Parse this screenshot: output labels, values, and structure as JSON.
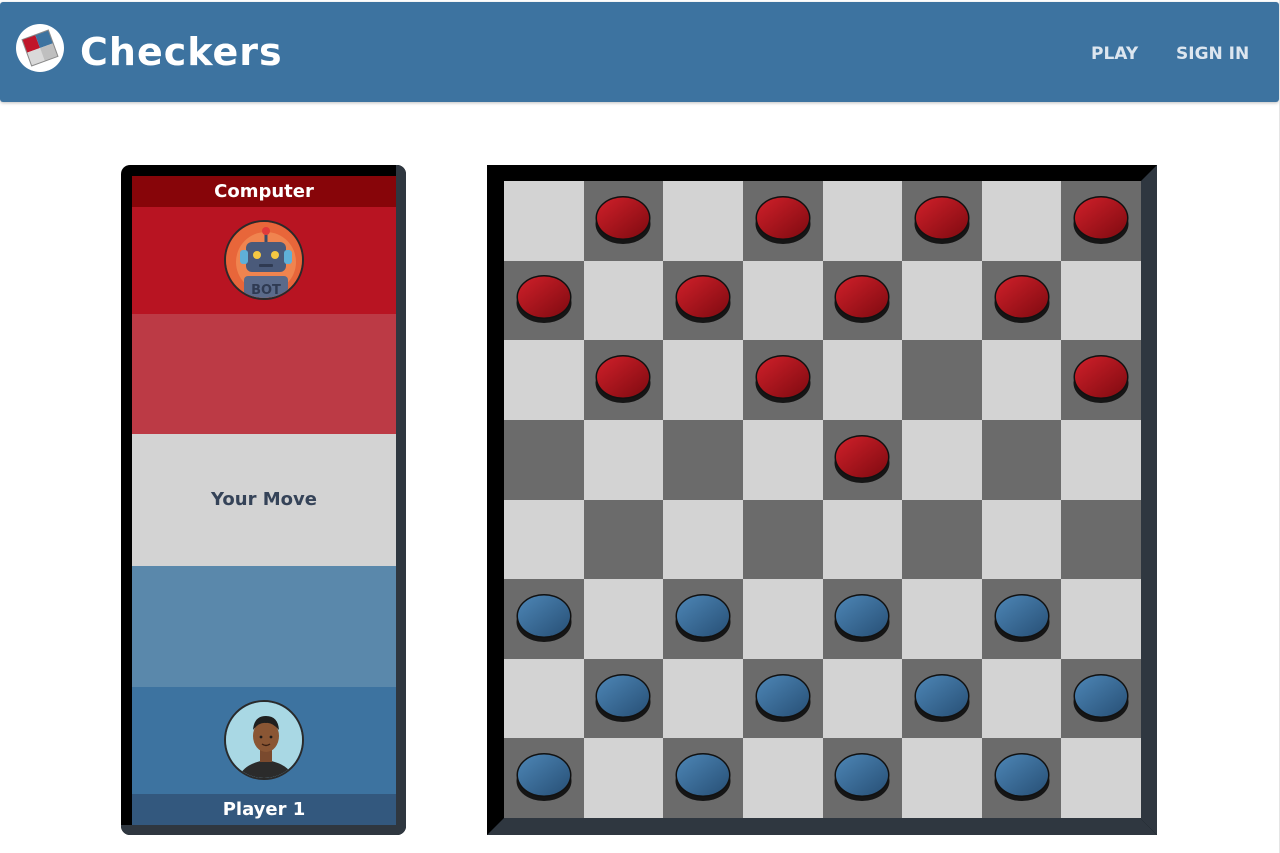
{
  "app": {
    "brand": "Checkers",
    "logo_icon": "checkers-logo-icon"
  },
  "nav": {
    "play": "PLAY",
    "sign_in": "SIGN IN"
  },
  "panel": {
    "opponent_name": "Computer",
    "opponent_avatar_icon": "robot-avatar-icon",
    "opponent_avatar_text": "BOT",
    "status": "Your Move",
    "player_name": "Player 1",
    "player_avatar_icon": "person-avatar-icon"
  },
  "board": {
    "size": 8,
    "pieces": [
      {
        "color": "red",
        "row": 0,
        "col": 1
      },
      {
        "color": "red",
        "row": 0,
        "col": 3
      },
      {
        "color": "red",
        "row": 0,
        "col": 5
      },
      {
        "color": "red",
        "row": 0,
        "col": 7
      },
      {
        "color": "red",
        "row": 1,
        "col": 0
      },
      {
        "color": "red",
        "row": 1,
        "col": 2
      },
      {
        "color": "red",
        "row": 1,
        "col": 4
      },
      {
        "color": "red",
        "row": 1,
        "col": 6
      },
      {
        "color": "red",
        "row": 2,
        "col": 1
      },
      {
        "color": "red",
        "row": 2,
        "col": 3
      },
      {
        "color": "red",
        "row": 2,
        "col": 7
      },
      {
        "color": "red",
        "row": 3,
        "col": 4
      },
      {
        "color": "blue",
        "row": 5,
        "col": 0
      },
      {
        "color": "blue",
        "row": 5,
        "col": 2
      },
      {
        "color": "blue",
        "row": 5,
        "col": 4
      },
      {
        "color": "blue",
        "row": 5,
        "col": 6
      },
      {
        "color": "blue",
        "row": 6,
        "col": 1
      },
      {
        "color": "blue",
        "row": 6,
        "col": 3
      },
      {
        "color": "blue",
        "row": 6,
        "col": 5
      },
      {
        "color": "blue",
        "row": 6,
        "col": 7
      },
      {
        "color": "blue",
        "row": 7,
        "col": 0
      },
      {
        "color": "blue",
        "row": 7,
        "col": 2
      },
      {
        "color": "blue",
        "row": 7,
        "col": 4
      },
      {
        "color": "blue",
        "row": 7,
        "col": 6
      }
    ]
  },
  "colors": {
    "navbar": "#3d73a0",
    "red_piece": "#b01019",
    "blue_piece": "#3d73a0",
    "light_square": "#d3d3d3",
    "dark_square": "#6b6b6b"
  }
}
